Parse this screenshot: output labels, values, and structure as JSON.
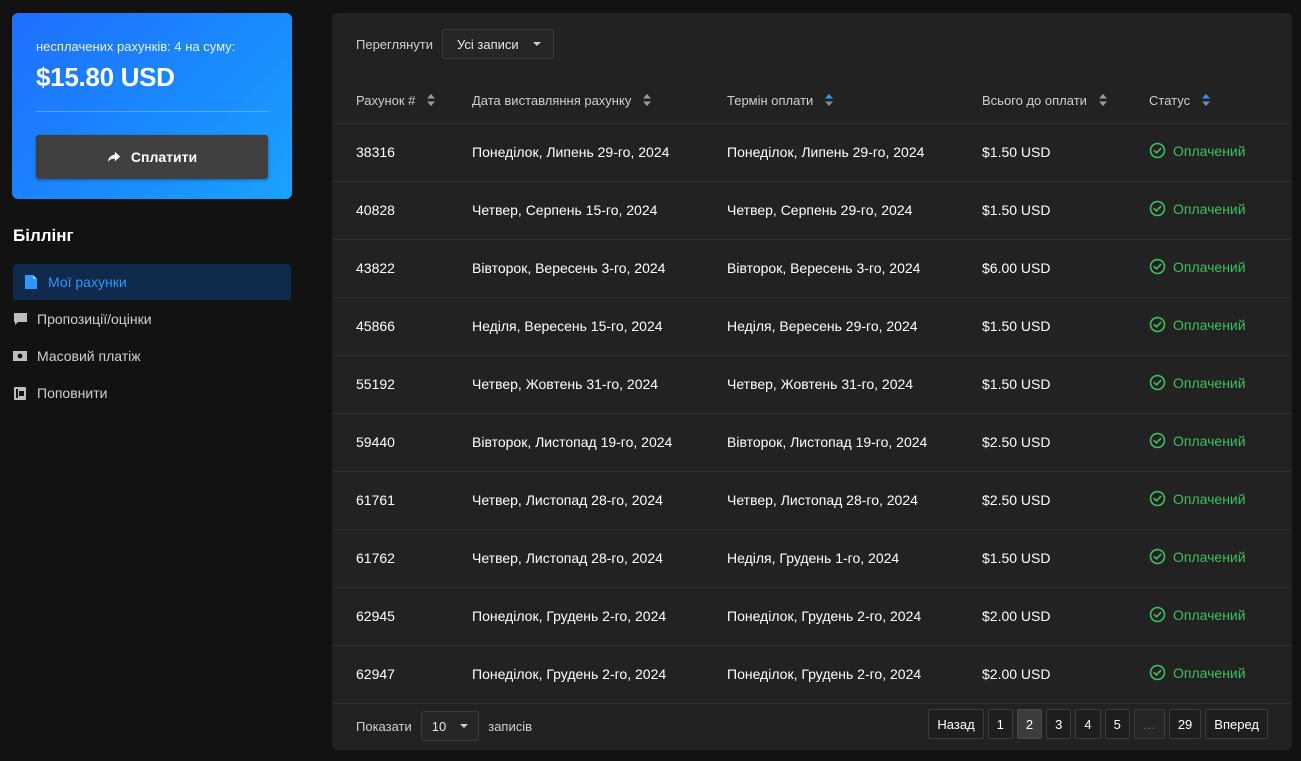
{
  "summary": {
    "label": "несплачених рахунків: 4 на суму:",
    "amount": "$15.80 USD",
    "pay_button": "Сплатити"
  },
  "sidebar": {
    "heading": "Біллінг",
    "items": [
      {
        "label": "Мої рахунки",
        "icon": "document-icon",
        "active": true
      },
      {
        "label": "Пропозиції/оцінки",
        "icon": "comment-icon",
        "active": false
      },
      {
        "label": "Масовий платіж",
        "icon": "money-icon",
        "active": false
      },
      {
        "label": "Поповнити",
        "icon": "wallet-icon",
        "active": false
      }
    ]
  },
  "filter": {
    "label": "Переглянути",
    "value": "Усі записи"
  },
  "table": {
    "headers": [
      "Рахунок #",
      "Дата виставляння рахунку",
      "Термін оплати",
      "Всього до оплати",
      "Статус"
    ],
    "rows": [
      {
        "id": "38316",
        "issued": "Понеділок, Липень 29-го, 2024",
        "due": "Понеділок, Липень 29-го, 2024",
        "total": "$1.50 USD",
        "status": "Оплачений"
      },
      {
        "id": "40828",
        "issued": "Четвер, Серпень 15-го, 2024",
        "due": "Четвер, Серпень 29-го, 2024",
        "total": "$1.50 USD",
        "status": "Оплачений"
      },
      {
        "id": "43822",
        "issued": "Вівторок, Вересень 3-го, 2024",
        "due": "Вівторок, Вересень 3-го, 2024",
        "total": "$6.00 USD",
        "status": "Оплачений"
      },
      {
        "id": "45866",
        "issued": "Неділя, Вересень 15-го, 2024",
        "due": "Неділя, Вересень 29-го, 2024",
        "total": "$1.50 USD",
        "status": "Оплачений"
      },
      {
        "id": "55192",
        "issued": "Четвер, Жовтень 31-го, 2024",
        "due": "Четвер, Жовтень 31-го, 2024",
        "total": "$1.50 USD",
        "status": "Оплачений"
      },
      {
        "id": "59440",
        "issued": "Вівторок, Листопад 19-го, 2024",
        "due": "Вівторок, Листопад 19-го, 2024",
        "total": "$2.50 USD",
        "status": "Оплачений"
      },
      {
        "id": "61761",
        "issued": "Четвер, Листопад 28-го, 2024",
        "due": "Четвер, Листопад 28-го, 2024",
        "total": "$2.50 USD",
        "status": "Оплачений"
      },
      {
        "id": "61762",
        "issued": "Четвер, Листопад 28-го, 2024",
        "due": "Неділя, Грудень 1-го, 2024",
        "total": "$1.50 USD",
        "status": "Оплачений"
      },
      {
        "id": "62945",
        "issued": "Понеділок, Грудень 2-го, 2024",
        "due": "Понеділок, Грудень 2-го, 2024",
        "total": "$2.00 USD",
        "status": "Оплачений"
      },
      {
        "id": "62947",
        "issued": "Понеділок, Грудень 2-го, 2024",
        "due": "Понеділок, Грудень 2-го, 2024",
        "total": "$2.00 USD",
        "status": "Оплачений"
      }
    ]
  },
  "footer": {
    "show_label": "Показати",
    "page_size": "10",
    "records_label": "записів",
    "pagination": {
      "prev": "Назад",
      "pages": [
        "1",
        "2",
        "3",
        "4",
        "5",
        "…",
        "29"
      ],
      "current": "2",
      "next": "Вперед"
    }
  },
  "colors": {
    "accent": "#1a8cff",
    "paid": "#3fbf5f",
    "sort_active": "#2f97ff"
  }
}
